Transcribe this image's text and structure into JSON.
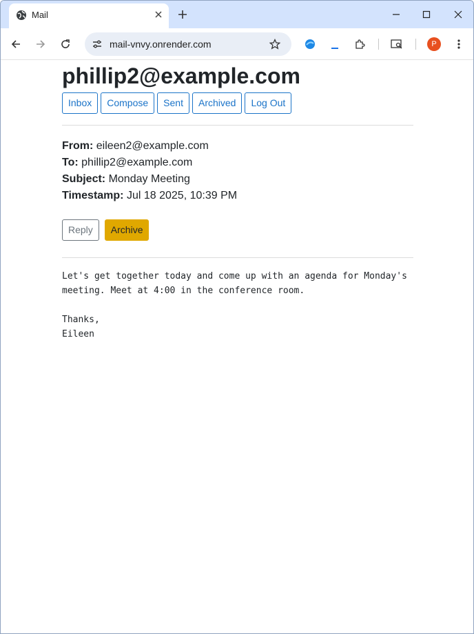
{
  "browser": {
    "tab_title": "Mail",
    "new_tab_symbol": "+",
    "url": "mail-vnvy.onrender.com",
    "profile_initial": "P",
    "icons": [
      "globe-icon",
      "close-icon",
      "plus-icon",
      "minimize-icon",
      "maximize-icon",
      "back-icon",
      "forward-icon",
      "reload-icon",
      "site-settings-icon",
      "star-icon",
      "extension-icon",
      "downloads-icon",
      "puzzle-icon",
      "search-tabs-icon",
      "menu-icon"
    ]
  },
  "page": {
    "user_email": "phillip2@example.com",
    "nav": {
      "inbox": "Inbox",
      "compose": "Compose",
      "sent": "Sent",
      "archived": "Archived",
      "logout": "Log Out"
    },
    "email": {
      "from_label": "From:",
      "from": "eileen2@example.com",
      "to_label": "To:",
      "to": "phillip2@example.com",
      "subject_label": "Subject:",
      "subject": "Monday Meeting",
      "timestamp_label": "Timestamp:",
      "timestamp": "Jul 18 2025, 10:39 PM",
      "body": "Let's get together today and come up with an agenda for Monday's\nmeeting. Meet at 4:00 in the conference room.\n\nThanks,\nEileen"
    },
    "actions": {
      "reply": "Reply",
      "archive": "Archive"
    }
  },
  "colors": {
    "tabstrip": "#d3e3fd",
    "nav_button": "#1a73c8",
    "archive_button": "#e0a800",
    "reply_button": "#6c757d",
    "avatar": "#e8501f"
  }
}
